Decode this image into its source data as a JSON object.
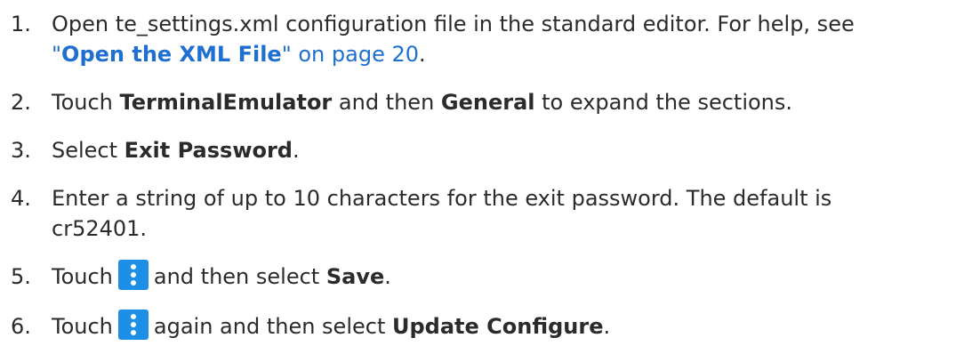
{
  "steps": [
    {
      "num": "1.",
      "text_a": "Open te_settings.xml configuration file in the standard editor. For help, see",
      "link_open_quote": "\"",
      "link_bold": "Open the XML File",
      "link_close": "\" on page 20",
      "end": "."
    },
    {
      "num": "2.",
      "pre": "Touch ",
      "bold1": "TerminalEmulator",
      "mid": " and then ",
      "bold2": "General",
      "post": " to expand the sections."
    },
    {
      "num": "3.",
      "pre": "Select ",
      "bold": "Exit Password",
      "post": "."
    },
    {
      "num": "4.",
      "line1": "Enter a string of up to 10 characters for the exit password. The default is",
      "line2": "cr52401."
    },
    {
      "num": "5.",
      "pre": "Touch",
      "icon": "vertical-ellipsis-menu-icon",
      "mid": "and then select ",
      "bold": "Save",
      "post": "."
    },
    {
      "num": "6.",
      "pre": "Touch",
      "icon": "vertical-ellipsis-menu-icon",
      "mid": "again and then select ",
      "bold": "Update Configure",
      "post": "."
    }
  ],
  "colors": {
    "text": "#2b2b2b",
    "link": "#1f6fd1",
    "icon_bg": "#1e8fe6"
  }
}
